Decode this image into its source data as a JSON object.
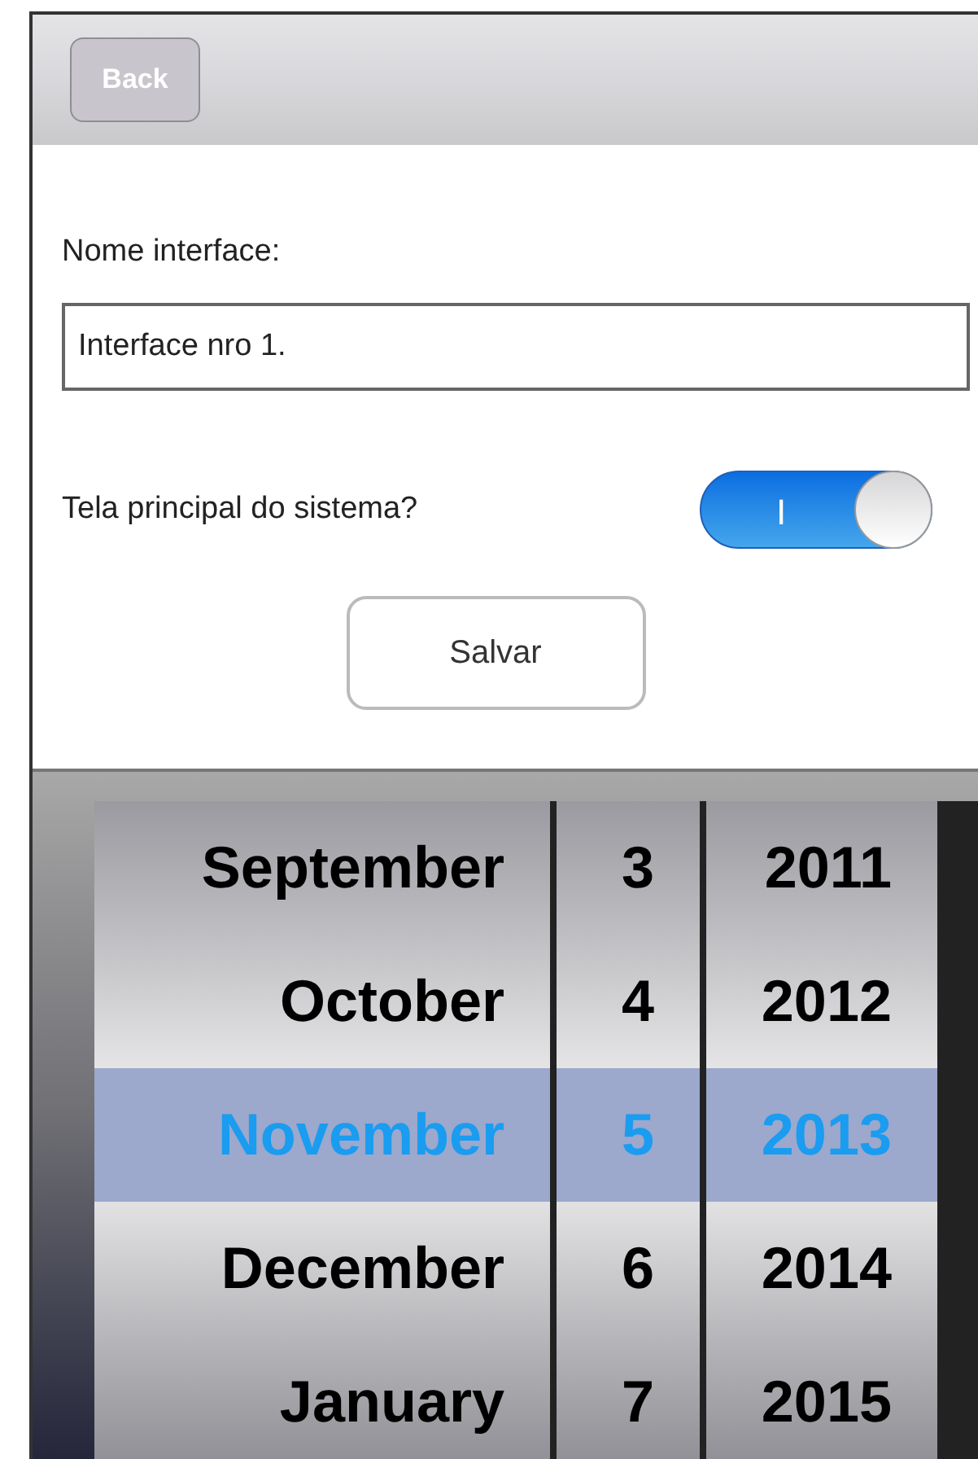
{
  "nav_bar": {
    "back_button": "Back"
  },
  "form": {
    "name_label": "Nome interface:",
    "name_value": "Interface nro 1.",
    "main_screen_label": "Tela principal do sistema?",
    "main_screen_toggle": {
      "on": true,
      "glyph": "I"
    },
    "save_button": "Salvar"
  },
  "picker": {
    "columns": [
      {
        "kind": "month",
        "items": [
          {
            "label": "September",
            "selected": false
          },
          {
            "label": "October",
            "selected": false
          },
          {
            "label": "November",
            "selected": true
          },
          {
            "label": "December",
            "selected": false
          },
          {
            "label": "January",
            "selected": false
          }
        ]
      },
      {
        "kind": "day",
        "items": [
          {
            "label": "3",
            "selected": false
          },
          {
            "label": "4",
            "selected": false
          },
          {
            "label": "5",
            "selected": true
          },
          {
            "label": "6",
            "selected": false
          },
          {
            "label": "7",
            "selected": false
          }
        ]
      },
      {
        "kind": "year",
        "items": [
          {
            "label": "2011",
            "selected": false
          },
          {
            "label": "2012",
            "selected": false
          },
          {
            "label": "2013",
            "selected": true
          },
          {
            "label": "2014",
            "selected": false
          },
          {
            "label": "2015",
            "selected": false
          }
        ]
      }
    ]
  }
}
